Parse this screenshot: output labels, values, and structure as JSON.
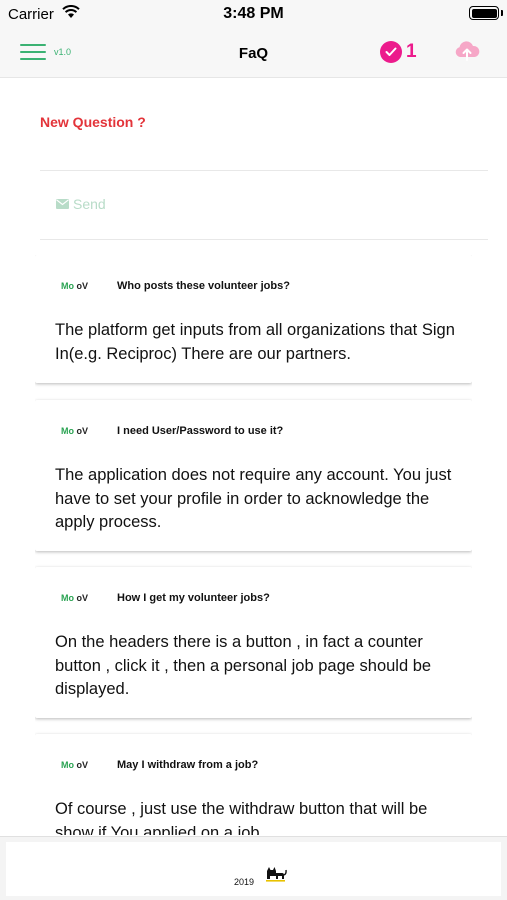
{
  "status_bar": {
    "carrier": "Carrier",
    "time": "3:48 PM"
  },
  "header": {
    "version": "v1.0",
    "title": "FaQ",
    "counter": "1",
    "accent_color": "#3bb273",
    "counter_color": "#ec1b8c",
    "icons": [
      "menu-icon",
      "check-icon",
      "cloud-upload-icon"
    ]
  },
  "form": {
    "new_question_label": "New Question ?",
    "send_label": "Send",
    "label_color": "#e3343a"
  },
  "faq": [
    {
      "logo_mo": "Mo",
      "logo_ov": "oV",
      "question": "Who posts these volunteer jobs?",
      "answer": "The platform get inputs from all organizations that Sign In(e.g. Reciproc) There are our partners."
    },
    {
      "logo_mo": "Mo",
      "logo_ov": "oV",
      "question": "I need User/Password to use it?",
      "answer": "The application does not require any account. You just have to set your profile in order to acknowledge the apply process."
    },
    {
      "logo_mo": "Mo",
      "logo_ov": "oV",
      "question": "How I get my volunteer jobs?",
      "answer": "On the headers there is a button , in fact a counter button , click it , then a personal job page should be displayed."
    },
    {
      "logo_mo": "Mo",
      "logo_ov": "oV",
      "question": "May I withdraw from a job?",
      "answer": "Of course , just use the withdraw button that will be show if You applied on a job."
    }
  ],
  "footer": {
    "year": "2019"
  }
}
